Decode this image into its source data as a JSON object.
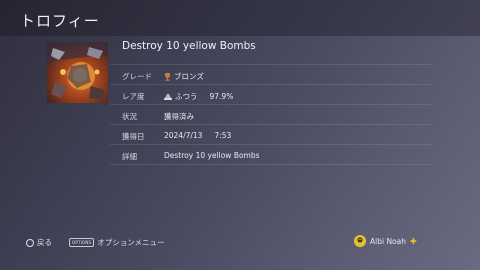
{
  "header": {
    "title": "トロフィー"
  },
  "trophy": {
    "title": "Destroy 10 yellow Bombs",
    "thumbnail_icon": "game-art-thumbnail"
  },
  "details": [
    {
      "label": "グレード",
      "value": "ブロンズ",
      "icon": "bronze-trophy-icon"
    },
    {
      "label": "レア度",
      "value": "ふつう",
      "value2": "97.9%",
      "icon": "rarity-icon"
    },
    {
      "label": "状況",
      "value": "獲得済み"
    },
    {
      "label": "獲得日",
      "value": "2024/7/13",
      "value2": "7:53"
    },
    {
      "label": "詳細",
      "value": "Destroy 10 yellow Bombs"
    }
  ],
  "footer": {
    "back_label": "戻る",
    "options_key": "OPTIONS",
    "options_label": "オプションメニュー",
    "user_name": "Albi Noah"
  },
  "colors": {
    "bronze": "#c8784a",
    "plus": "#f0c030",
    "avatar": "#e0c030"
  }
}
